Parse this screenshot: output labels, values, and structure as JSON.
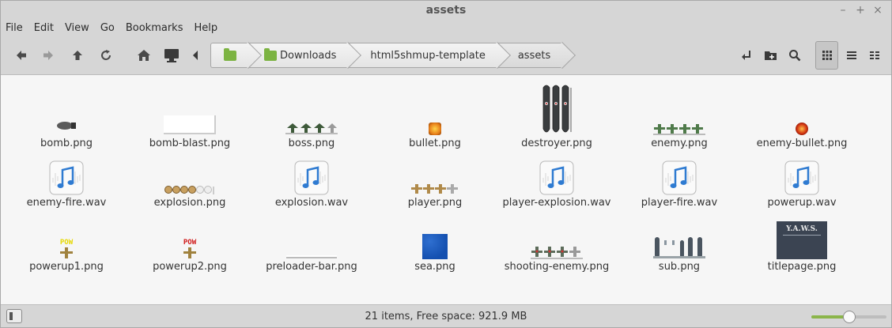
{
  "window": {
    "title": "assets",
    "controls": [
      "–",
      "+",
      "×"
    ]
  },
  "menu": [
    "File",
    "Edit",
    "View",
    "Go",
    "Bookmarks",
    "Help"
  ],
  "toolbar": {
    "breadcrumbs": [
      "",
      "Downloads",
      "html5shmup-template",
      "assets"
    ]
  },
  "files": [
    {
      "name": "bomb.png",
      "type": "image"
    },
    {
      "name": "bomb-blast.png",
      "type": "image"
    },
    {
      "name": "boss.png",
      "type": "image"
    },
    {
      "name": "bullet.png",
      "type": "image"
    },
    {
      "name": "destroyer.png",
      "type": "image"
    },
    {
      "name": "enemy.png",
      "type": "image"
    },
    {
      "name": "enemy-bullet.png",
      "type": "image"
    },
    {
      "name": "enemy-fire.wav",
      "type": "audio"
    },
    {
      "name": "explosion.png",
      "type": "image"
    },
    {
      "name": "explosion.wav",
      "type": "audio"
    },
    {
      "name": "player.png",
      "type": "image"
    },
    {
      "name": "player-explosion.wav",
      "type": "audio"
    },
    {
      "name": "player-fire.wav",
      "type": "audio"
    },
    {
      "name": "powerup.wav",
      "type": "audio"
    },
    {
      "name": "powerup1.png",
      "type": "image"
    },
    {
      "name": "powerup2.png",
      "type": "image"
    },
    {
      "name": "preloader-bar.png",
      "type": "image"
    },
    {
      "name": "sea.png",
      "type": "image"
    },
    {
      "name": "shooting-enemy.png",
      "type": "image"
    },
    {
      "name": "sub.png",
      "type": "image"
    },
    {
      "name": "titlepage.png",
      "type": "image"
    }
  ],
  "thumbs": {
    "pow_text": "POW",
    "yaws_text": "Y.A.W.S."
  },
  "status": {
    "text": "21 items, Free space: 921.9 MB",
    "zoom_fraction": 0.5
  },
  "colors": {
    "accent": "#8bb54a",
    "folder": "#7cb342",
    "audio_icon": "#2f7bd1"
  }
}
